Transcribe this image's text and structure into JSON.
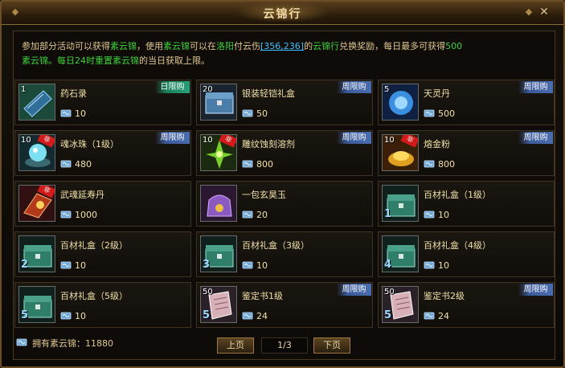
{
  "window": {
    "title": "云锦行",
    "close_label": "✕",
    "corner_left": "◆",
    "corner_right": "◆"
  },
  "description": {
    "p1": "参加部分活动可以获得",
    "p2": "素云锦",
    "p3": "，使用",
    "p4": "素云锦",
    "p5": "可以在",
    "p6": "洛阳",
    "p7": "付云伤",
    "p8": "[356,236]",
    "p9": "的",
    "p10": "云锦行",
    "p11": "兑换奖励，每日最多可获得",
    "p12": "500",
    "p13": "素云锦",
    "p14": "。每日24时重置",
    "p15": "素云锦",
    "p16": "的当日获取上限。"
  },
  "colors": {
    "accent_green": "#3fd23a",
    "link_blue": "#3ec2ff",
    "text_gold": "#e0c890",
    "weekly_tag": "#4a6db0",
    "daily_tag": "#27a077",
    "non_trade": "#d21a1a"
  },
  "items": [
    {
      "name": "药石录",
      "qty": "1",
      "price": "10",
      "tag": "日限购",
      "icon": "scroll-book-icon",
      "nontrade": ""
    },
    {
      "name": "银装轻铠礼盒",
      "qty": "20",
      "price": "50",
      "tag": "周限购",
      "icon": "silver-chest-icon",
      "nontrade": ""
    },
    {
      "name": "天灵丹",
      "qty": "5",
      "price": "500",
      "tag": "周限购",
      "icon": "blue-orb-icon",
      "nontrade": ""
    },
    {
      "name": "魂冰珠（1级）",
      "qty": "10",
      "price": "480",
      "tag": "周限购",
      "icon": "ice-pearl-icon",
      "nontrade": "非"
    },
    {
      "name": "雕纹蚀刻溶剂",
      "qty": "10",
      "price": "800",
      "tag": "周限购",
      "icon": "green-solvent-icon",
      "nontrade": "非"
    },
    {
      "name": "熔金粉",
      "qty": "10",
      "price": "800",
      "tag": "周限购",
      "icon": "gold-powder-icon",
      "nontrade": "非"
    },
    {
      "name": "武魂延寿丹",
      "qty": "",
      "price": "1000",
      "tag": "",
      "icon": "red-book-icon",
      "nontrade": "非"
    },
    {
      "name": "一包玄昊玉",
      "qty": "",
      "price": "20",
      "tag": "",
      "icon": "jade-bag-icon",
      "nontrade": ""
    },
    {
      "name": "百材礼盒（1级）",
      "qty": "",
      "price": "10",
      "tag": "",
      "icon": "green-chest-icon",
      "nontrade": "",
      "lvl": "1"
    },
    {
      "name": "百材礼盒（2级）",
      "qty": "",
      "price": "10",
      "tag": "",
      "icon": "green-chest-icon",
      "nontrade": "",
      "lvl": "2"
    },
    {
      "name": "百材礼盒（3级）",
      "qty": "",
      "price": "10",
      "tag": "",
      "icon": "green-chest-icon",
      "nontrade": "",
      "lvl": "3"
    },
    {
      "name": "百材礼盒（4级）",
      "qty": "",
      "price": "10",
      "tag": "",
      "icon": "green-chest-icon",
      "nontrade": "",
      "lvl": "4"
    },
    {
      "name": "百材礼盒（5级）",
      "qty": "",
      "price": "10",
      "tag": "",
      "icon": "green-chest-icon",
      "nontrade": "",
      "lvl": "5"
    },
    {
      "name": "鉴定书1级",
      "qty": "50",
      "price": "24",
      "tag": "周限购",
      "icon": "appraisal-scroll-icon",
      "nontrade": "",
      "lvl": "5"
    },
    {
      "name": "鉴定书2级",
      "qty": "50",
      "price": "24",
      "tag": "周限购",
      "icon": "appraisal-scroll-icon",
      "nontrade": "",
      "lvl": "5"
    }
  ],
  "footer": {
    "owned_label": "拥有素云锦：",
    "owned_value": "11880",
    "prev_label": "上页",
    "page": "1/3",
    "next_label": "下页"
  }
}
